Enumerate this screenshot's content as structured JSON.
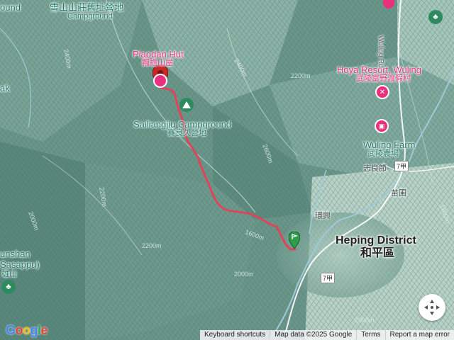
{
  "map": {
    "labels": {
      "xueshan_old_camp_zh": "雪山山莊舊址營地",
      "xueshan_old_camp_en": "Campground",
      "piaodan_hut_en": "Piaodan Hut",
      "piaodan_hut_zh": "飄擔山屋",
      "sailiangjiu_en": "Sailiangjiu Campground",
      "sailiangjiu_zh": "賽良久營地",
      "hoya_en": "Hoya Resort, Wuling",
      "hoya_zh": "武陵富野渡假村",
      "wuling_farm_en": "Wuling Farm",
      "wuling_farm_zh": "武陵農場",
      "heping_en": "Heping District",
      "heping_zh": "和平區",
      "zhiliangjie": "志良節",
      "yuanpu": "苗圃",
      "huanxing": "環興",
      "wuling_rd": "Wuling Rd",
      "edge_left_top": "ound",
      "edge_left_mid": "ak",
      "edge_left_shan": "unshan",
      "edge_left_sasappu": "Sasappu)",
      "edge_left_zh": "雄山"
    },
    "road_shields": [
      "7甲",
      "7甲"
    ],
    "contours": [
      "2400m",
      "2200m",
      "2000m",
      "1800m",
      "2600m",
      "2400m",
      "2200m",
      "2000m",
      "1600m",
      "2000m",
      "2200m"
    ],
    "icons": [
      "red-pin-icon",
      "green-pin-icon",
      "campground-icon",
      "hotel-icon",
      "camera-icon",
      "park-icon",
      "compass-icon"
    ]
  },
  "footer": {
    "google": "Google",
    "shortcuts": "Keyboard shortcuts",
    "mapdata": "Map data ©2025 Google",
    "terms": "Terms",
    "report": "Report a map error"
  },
  "colors": {
    "route": "#e0445a",
    "pink": "#e8307e",
    "teal": "#1d7a6a"
  }
}
